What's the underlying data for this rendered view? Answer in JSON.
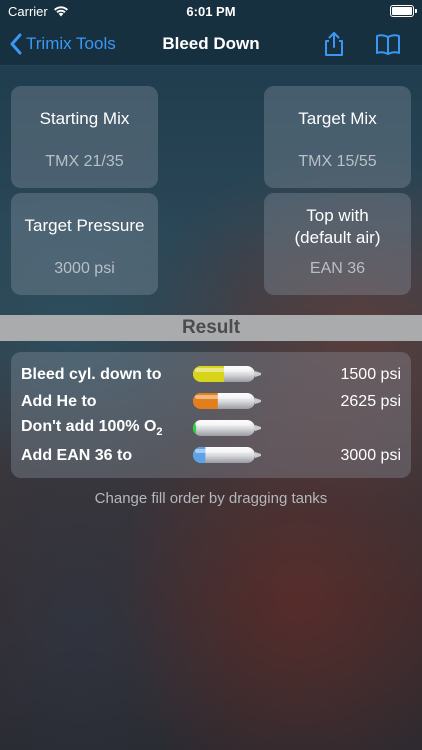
{
  "status_bar": {
    "carrier": "Carrier",
    "time": "6:01 PM"
  },
  "nav": {
    "back_label": "Trimix Tools",
    "title": "Bleed Down",
    "accent_color": "#3b97f4"
  },
  "cards": {
    "starting_mix": {
      "title": "Starting Mix",
      "value": "TMX 21/35"
    },
    "target_mix": {
      "title": "Target Mix",
      "value": "TMX 15/55"
    },
    "target_pressure": {
      "title": "Target Pressure",
      "value": "3000 psi"
    },
    "top_with": {
      "title_line1": "Top with",
      "title_line2": "(default air)",
      "value": "EAN 36"
    }
  },
  "result": {
    "header": "Result",
    "rows": [
      {
        "label": "Bleed cyl. down to",
        "value": "1500 psi",
        "tank_color": "#d8d41a",
        "tank_fill": 0.5
      },
      {
        "label": "Add He to",
        "value": "2625 psi",
        "tank_color": "#e37e1c",
        "tank_fill": 0.4
      },
      {
        "label_prefix": "Don't add 100% O",
        "label_sub": "2",
        "value": "",
        "tank_color": "#2fd03b",
        "tank_fill": 0.05
      },
      {
        "label": "Add EAN 36 to",
        "value": "3000 psi",
        "tank_color": "#5ba2e6",
        "tank_fill": 0.2
      }
    ]
  },
  "footnote": "Change fill order by dragging tanks"
}
